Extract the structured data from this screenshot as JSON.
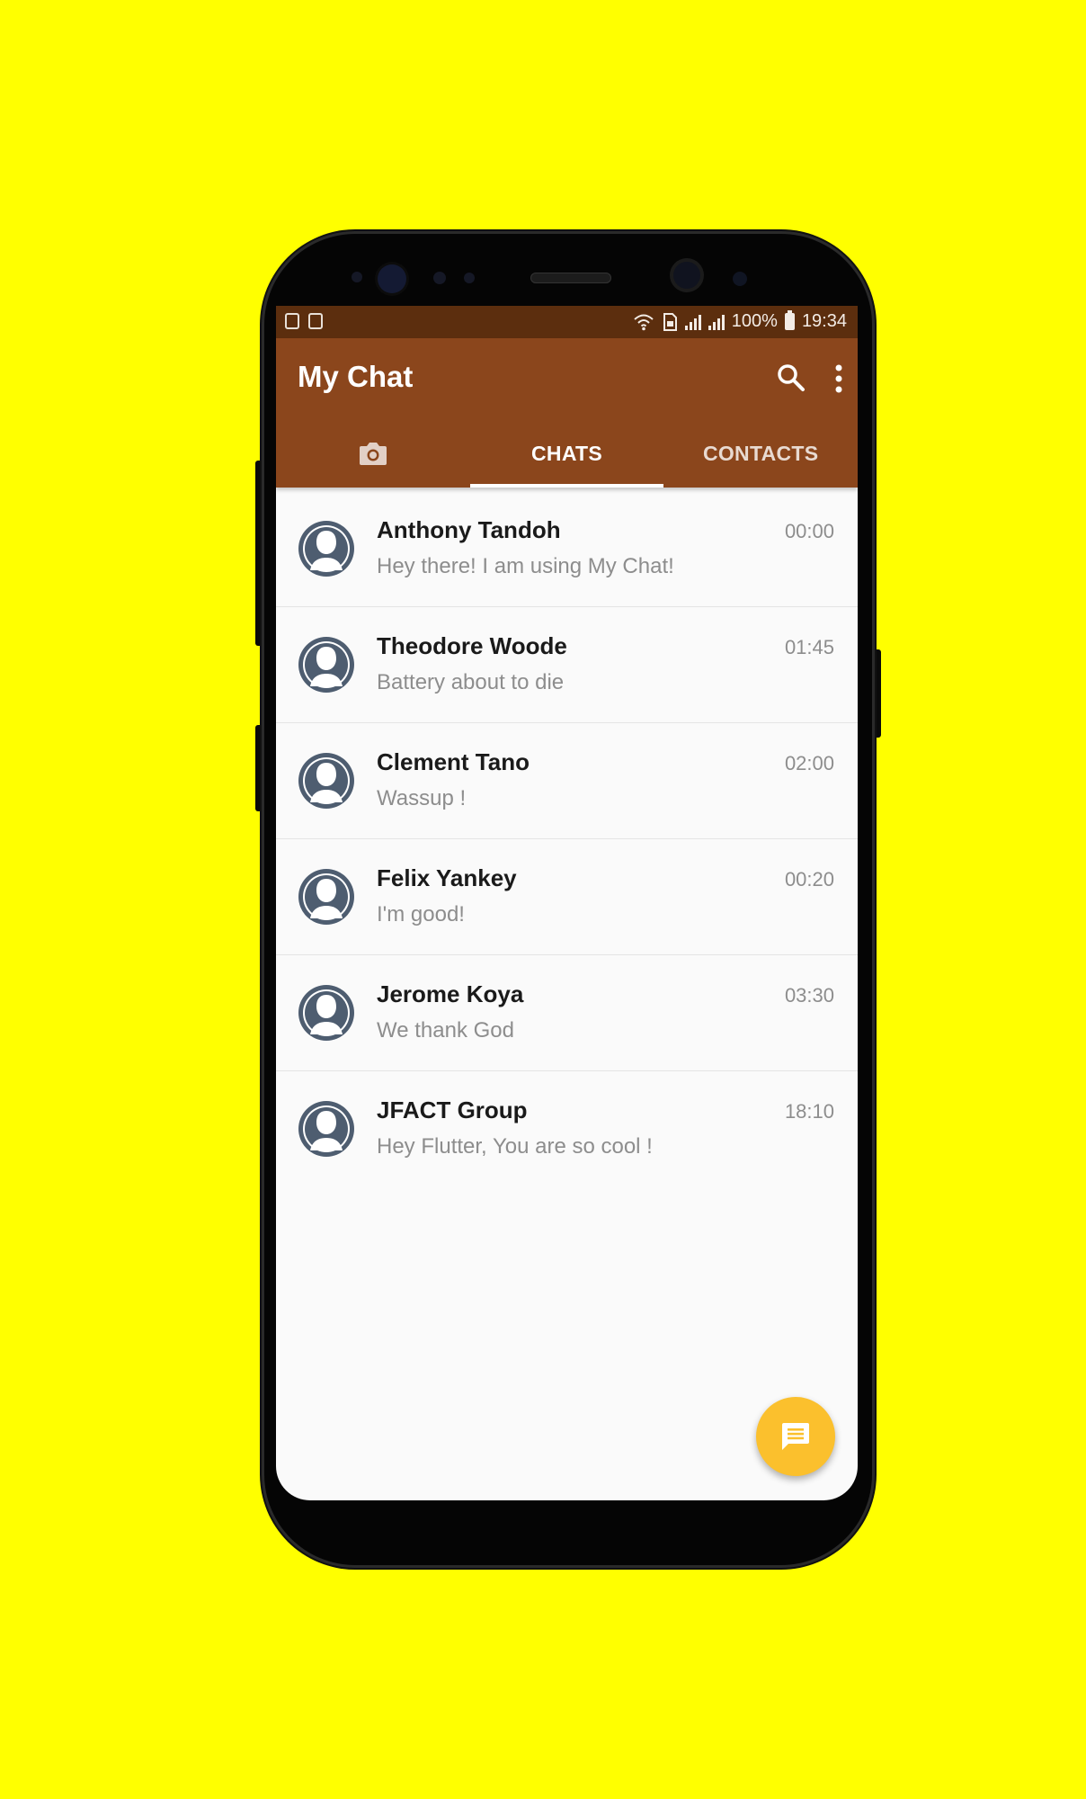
{
  "app": {
    "title": "My Chat"
  },
  "status_bar": {
    "battery": "100%",
    "time": "19:34"
  },
  "tabs": [
    {
      "label": "",
      "icon": "camera-icon"
    },
    {
      "label": "CHATS",
      "active": true
    },
    {
      "label": "CONTACTS"
    }
  ],
  "chats": [
    {
      "name": "Anthony Tandoh",
      "message": "Hey there! I am using My Chat!",
      "time": "00:00"
    },
    {
      "name": "Theodore Woode",
      "message": "Battery about to die",
      "time": "01:45"
    },
    {
      "name": "Clement Tano",
      "message": "Wassup !",
      "time": "02:00"
    },
    {
      "name": "Felix Yankey",
      "message": "I'm good!",
      "time": "00:20"
    },
    {
      "name": "Jerome Koya",
      "message": "We thank God",
      "time": "03:30"
    },
    {
      "name": "JFACT Group",
      "message": "Hey Flutter, You are so cool !",
      "time": "18:10"
    }
  ],
  "icons": {
    "search": "search-icon",
    "more": "more-vert-icon",
    "fab": "message-icon",
    "avatar": "person-icon"
  },
  "colors": {
    "background": "#FFFF00",
    "app_bar": "#8B461C",
    "status_bar": "#5C2E0E",
    "fab": "#FBC02D",
    "avatar": "#4E5D70"
  }
}
